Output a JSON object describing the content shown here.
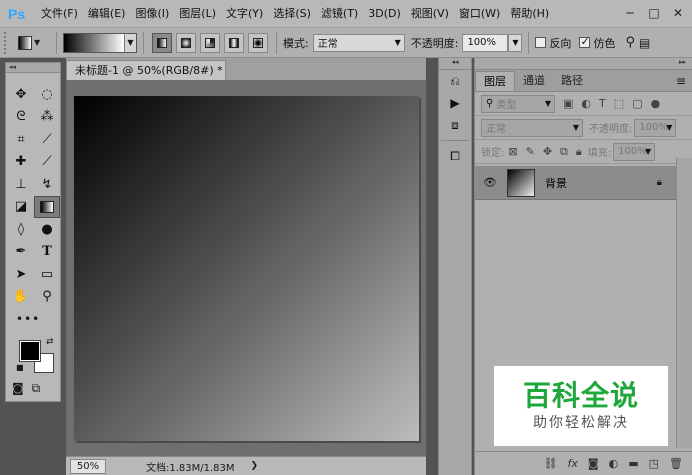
{
  "app": {
    "logo": "Ps"
  },
  "menu": [
    "文件(F)",
    "编辑(E)",
    "图像(I)",
    "图层(L)",
    "文字(Y)",
    "选择(S)",
    "滤镜(T)",
    "3D(D)",
    "视图(V)",
    "窗口(W)",
    "帮助(H)"
  ],
  "window_controls": [
    "─",
    "□",
    "✕"
  ],
  "options": {
    "mode_label": "模式:",
    "mode_value": "正常",
    "opacity_label": "不透明度:",
    "opacity_value": "100%",
    "reverse_label": "反向",
    "reverse_checked": false,
    "dither_label": "仿色",
    "dither_checked": true
  },
  "document": {
    "tab_title": "未标题-1 @ 50%(RGB/8#) *",
    "zoom": "50%",
    "doc_size": "文档:1.83M/1.83M"
  },
  "layers_panel": {
    "tabs": [
      "图层",
      "通道",
      "路径"
    ],
    "active_tab": 0,
    "filter_kind": "类型",
    "blend_mode": "正常",
    "opacity_label": "不透明度:",
    "opacity_value": "100%",
    "lock_label": "锁定:",
    "fill_label": "填充:",
    "fill_value": "100%",
    "layers": [
      {
        "name": "背景",
        "visible": true,
        "locked": true
      }
    ]
  },
  "watermark": {
    "title": "百科全说",
    "subtitle": "助你轻松解决",
    "title_color": "#1fa83a"
  }
}
